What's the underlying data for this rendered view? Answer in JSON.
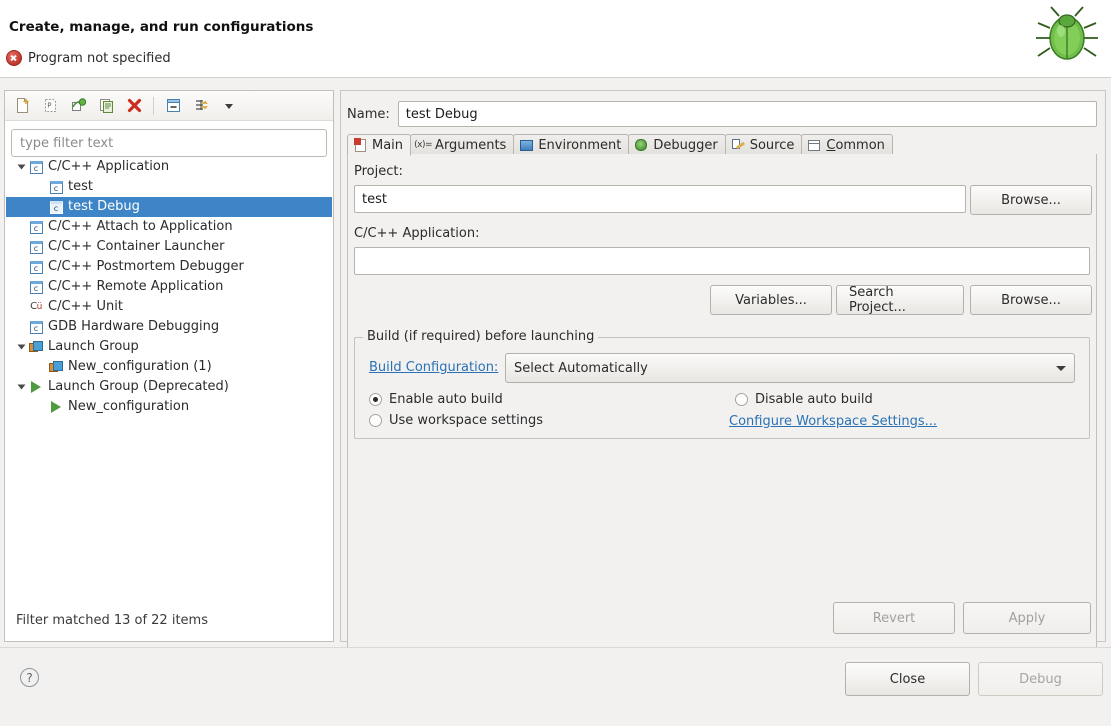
{
  "header": {
    "title": "Create, manage, and run configurations",
    "status_text": "Program not specified",
    "status_icon": "error-icon",
    "decoration_icon": "green-bug-icon"
  },
  "left_panel": {
    "toolbar": [
      {
        "name": "new-launch-configuration",
        "icon": "new-document-icon"
      },
      {
        "name": "new-prototype",
        "icon": "new-prototype-icon"
      },
      {
        "name": "export-configuration",
        "icon": "export-icon"
      },
      {
        "name": "duplicate-configuration",
        "icon": "duplicate-icon"
      },
      {
        "name": "delete-configuration",
        "icon": "red-x-icon"
      },
      {
        "name": "collapse-all",
        "icon": "collapse-all-icon"
      },
      {
        "name": "filter-launch-configurations",
        "icon": "filter-icon"
      },
      {
        "name": "view-menu",
        "icon": "chevron-down-icon"
      }
    ],
    "filter": {
      "placeholder": "type filter text",
      "value": ""
    },
    "tree": [
      {
        "label": "C/C++ Application",
        "icon": "c-file-icon",
        "indent": 0,
        "twisty": "expanded",
        "selected": false
      },
      {
        "label": "test",
        "icon": "c-file-icon",
        "indent": 1,
        "twisty": "none",
        "selected": false
      },
      {
        "label": "test Debug",
        "icon": "c-file-icon",
        "indent": 1,
        "twisty": "none",
        "selected": true
      },
      {
        "label": "C/C++ Attach to Application",
        "icon": "c-file-icon",
        "indent": 0,
        "twisty": "none",
        "selected": false
      },
      {
        "label": "C/C++ Container Launcher",
        "icon": "c-file-icon",
        "indent": 0,
        "twisty": "none",
        "selected": false
      },
      {
        "label": "C/C++ Postmortem Debugger",
        "icon": "c-file-icon",
        "indent": 0,
        "twisty": "none",
        "selected": false
      },
      {
        "label": "C/C++ Remote Application",
        "icon": "c-file-icon",
        "indent": 0,
        "twisty": "none",
        "selected": false
      },
      {
        "label": "C/C++ Unit",
        "icon": "cunit-icon",
        "indent": 0,
        "twisty": "none",
        "selected": false
      },
      {
        "label": "GDB Hardware Debugging",
        "icon": "c-file-icon",
        "indent": 0,
        "twisty": "none",
        "selected": false
      },
      {
        "label": "Launch Group",
        "icon": "launch-group-icon",
        "indent": 0,
        "twisty": "expanded",
        "selected": false
      },
      {
        "label": "New_configuration (1)",
        "icon": "launch-group-icon",
        "indent": 1,
        "twisty": "none",
        "selected": false
      },
      {
        "label": "Launch Group (Deprecated)",
        "icon": "green-play-icon",
        "indent": 0,
        "twisty": "expanded",
        "selected": false
      },
      {
        "label": "New_configuration",
        "icon": "green-play-icon",
        "indent": 1,
        "twisty": "none",
        "selected": false
      }
    ],
    "filter_status": "Filter matched 13 of 22 items"
  },
  "right_panel": {
    "name_label": "Name:",
    "name_value": "test Debug",
    "tabs": [
      {
        "label": "Main",
        "icon": "main-tab-icon",
        "active": true
      },
      {
        "label": "Arguments",
        "icon": "arguments-tab-icon",
        "active": false
      },
      {
        "label": "Environment",
        "icon": "environment-tab-icon",
        "active": false
      },
      {
        "label": "Debugger",
        "icon": "debugger-tab-icon",
        "active": false
      },
      {
        "label": "Source",
        "icon": "source-tab-icon",
        "active": false
      },
      {
        "label": "Common",
        "icon": "common-tab-icon",
        "active": false,
        "mnemonic": "C"
      }
    ],
    "main_tab": {
      "project_label": "Project:",
      "project_value": "test",
      "project_browse_label": "Browse...",
      "application_label": "C/C++ Application:",
      "application_value": "",
      "variables_label": "Variables...",
      "search_project_label": "Search Project...",
      "app_browse_label": "Browse...",
      "build_group_title": "Build (if required) before launching",
      "build_configuration_link": "Build Configuration:",
      "build_configuration_value": "Select Automatically",
      "radio_enable_auto_build": "Enable auto build",
      "radio_disable_auto_build": "Disable auto build",
      "radio_use_workspace_settings": "Use workspace settings",
      "configure_workspace_link": "Configure Workspace Settings...",
      "selected_radio": "enable_auto_build"
    },
    "revert_label": "Revert",
    "revert_enabled": false,
    "apply_label": "Apply",
    "apply_enabled": false
  },
  "footer": {
    "help_glyph": "?",
    "close_label": "Close",
    "debug_label": "Debug",
    "debug_enabled": false
  },
  "colors": {
    "selection_blue": "#3d85c6",
    "link_blue": "#2a72b5",
    "error_red": "#c0392b",
    "window_bg": "#f2f1f0",
    "panel_white": "#ffffff"
  }
}
